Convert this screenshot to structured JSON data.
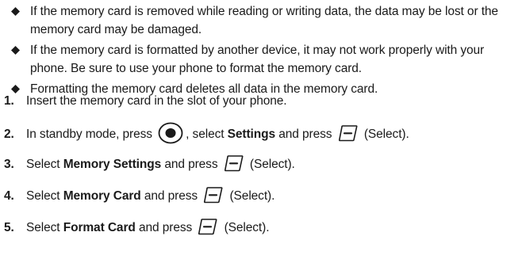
{
  "bullets": [
    "If the memory card is removed while reading or writing data, the data may be lost or the memory card may be damaged.",
    "If the memory card is formatted by another device, it may not work properly with your phone. Be sure to use your phone to format the memory card.",
    "Formatting the memory card deletes all data in the memory card."
  ],
  "icons": {
    "bullet": "diamond-icon",
    "nav_center": "nav-center-key-icon",
    "soft_key": "left-soft-key-icon"
  },
  "steps": {
    "s1": {
      "num": "1.",
      "text": "Insert the memory card in the slot of your phone."
    },
    "s2": {
      "num": "2.",
      "pre": "In standby mode, press",
      "mid": ", select",
      "bold": "Settings",
      "post": "and press",
      "action": "(Select)."
    },
    "s3": {
      "num": "3.",
      "pre": "Select",
      "bold": "Memory Settings",
      "post": "and press",
      "action": "(Select)."
    },
    "s4": {
      "num": "4.",
      "pre": "Select",
      "bold": "Memory Card",
      "post": "and press",
      "action": "(Select)."
    },
    "s5": {
      "num": "5.",
      "pre": "Select",
      "bold": "Format Card",
      "post": "and press",
      "action": "(Select)."
    }
  }
}
